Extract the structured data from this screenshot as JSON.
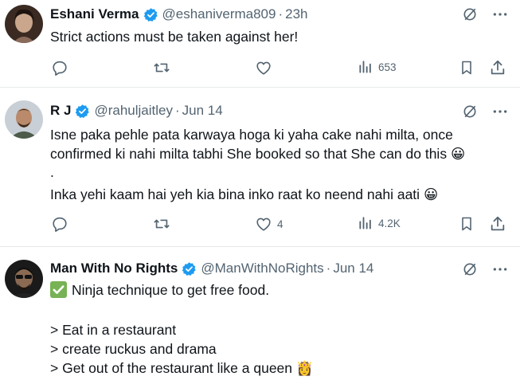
{
  "tweets": [
    {
      "author": "Eshani Verma",
      "handle": "@eshaniverma809",
      "separator": "·",
      "time": "23h",
      "lines": [
        "Strict actions must be taken against her!"
      ],
      "views": "653",
      "likes": ""
    },
    {
      "author": "R J",
      "handle": "@rahuljaitley",
      "separator": "·",
      "time": "Jun 14",
      "lines": [
        "Isne paka pehle pata karwaya hoga ki yaha cake nahi milta, once",
        "confirmed ki nahi milta tabhi She booked so that She can do this",
        ".",
        "Inka yehi kaam hai yeh kia bina inko raat ko neend nahi aati"
      ],
      "emoji_1": "😀",
      "emoji_2": "😀",
      "views": "4.2K",
      "likes": "4"
    },
    {
      "author": "Man With No Rights",
      "handle": "@ManWithNoRights",
      "separator": "·",
      "time": "Jun 14",
      "check_emoji": "✅",
      "lines": [
        "Ninja technique to get free food.",
        "> Eat in a restaurant",
        "> create ruckus and drama",
        "> Get out of the restaurant like a queen"
      ],
      "queen_emoji": "👸"
    }
  ],
  "colors": {
    "text": "#0f1419",
    "muted": "#536471",
    "verified": "#1d9bf0",
    "divider": "#e7e9ea"
  },
  "icons": [
    "grok-icon",
    "more-icon",
    "reply-icon",
    "retweet-icon",
    "like-icon",
    "views-icon",
    "bookmark-icon",
    "share-icon",
    "verified-badge-icon"
  ]
}
